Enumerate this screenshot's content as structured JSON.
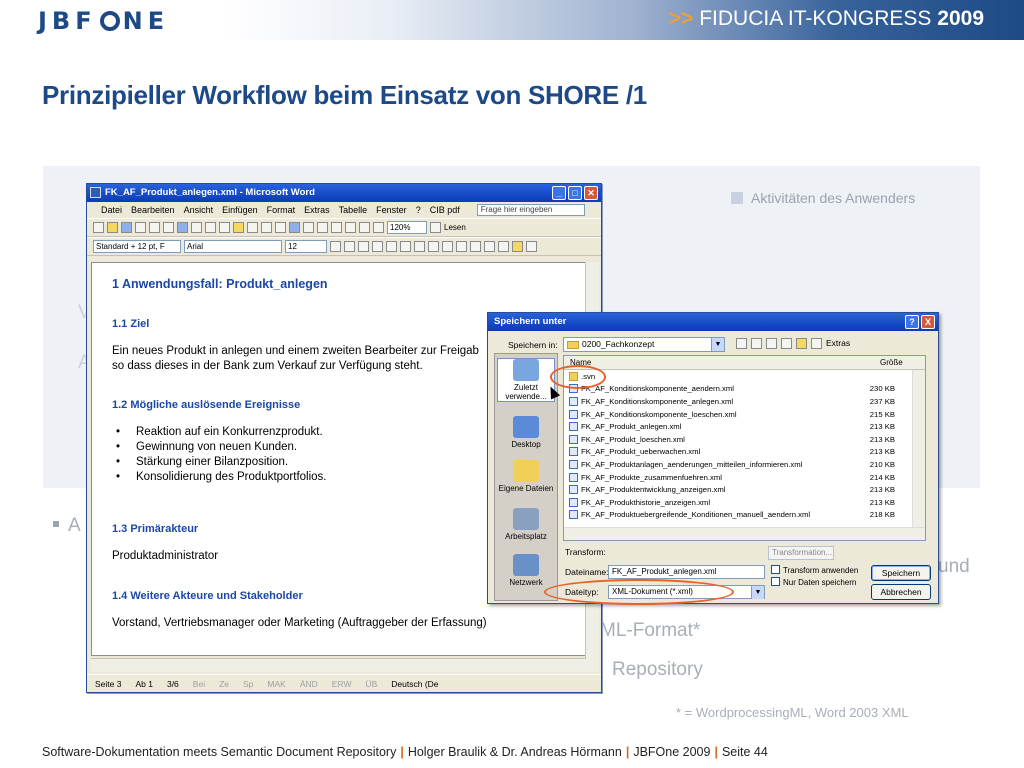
{
  "header": {
    "logo_pre": "JBF",
    "logo_post": "NE",
    "kongress_arrows": ">>",
    "kongress_text": "FIDUCIA IT-KONGRESS",
    "kongress_year": "2009"
  },
  "title": "Prinzipieller Workflow beim Einsatz von SHORE  /1",
  "panel": {
    "legend": "Aktivitäten des Anwenders",
    "ghost_left_1": "V",
    "ghost_left_2": "A",
    "ghost_bullet": "A",
    "ghost_und": "und",
    "ghost_ml": "ML-Format*",
    "ghost_repo": "Repository"
  },
  "footnote": "* = WordprocessingML, Word 2003 XML",
  "footer": {
    "part1": "Software-Dokumentation meets Semantic Document Repository",
    "sep": "|",
    "part2": "Holger Braulik & Dr. Andreas Hörmann",
    "part3": "JBFOne 2009",
    "part4": "Seite 44"
  },
  "word": {
    "title": "FK_AF_Produkt_anlegen.xml - Microsoft Word",
    "menu": [
      "Datei",
      "Bearbeiten",
      "Ansicht",
      "Einfügen",
      "Format",
      "Extras",
      "Tabelle",
      "Fenster",
      "?",
      "CIB pdf"
    ],
    "help_placeholder": "Frage hier eingeben",
    "zoom": "120%",
    "lesen": "Lesen",
    "style": "Standard + 12 pt, F",
    "font": "Arial",
    "size": "12",
    "doc": {
      "h1": "1  Anwendungsfall: Produkt_anlegen",
      "h_ziel": "1.1  Ziel",
      "ziel_line1": "Ein neues Produkt in anlegen und einem zweiten Bearbeiter zur Freigab",
      "ziel_line2": "so dass dieses in der Bank zum Verkauf zur Verfügung steht.",
      "h_ereignisse": "1.2  Mögliche auslösende Ereignisse",
      "ereignisse": [
        "Reaktion auf ein Konkurrenzprodukt.",
        "Gewinnung von neuen Kunden.",
        "Stärkung einer Bilanzposition.",
        "Konsolidierung des Produktportfolios."
      ],
      "h_primaer": "1.3  Primärakteur",
      "primaer": "Produktadministrator",
      "h_weitere": "1.4  Weitere Akteure und Stakeholder",
      "weitere": "Vorstand, Vertriebsmanager oder Marketing (Auftraggeber der Erfassung)"
    },
    "status": {
      "seite": "Seite  3",
      "ab": "Ab  1",
      "pages": "3/6",
      "bei": "Bei",
      "ze": "Ze",
      "sp": "Sp",
      "mak": "MAK",
      "aend": "ÄND",
      "erw": "ERW",
      "ub": "ÜB",
      "lang": "Deutsch (De"
    }
  },
  "save_dialog": {
    "title": "Speichern unter",
    "speichern_in_label": "Speichern in:",
    "folder": "0200_Fachkonzept",
    "extras": "Extras",
    "col_name": "Name",
    "col_size": "Größe",
    "places": [
      "Zuletzt verwende...",
      "Desktop",
      "Eigene Dateien",
      "Arbeitsplatz",
      "Netzwerk"
    ],
    "files": [
      {
        "name": ".svn",
        "size": "",
        "folder": true
      },
      {
        "name": "FK_AF_Konditionskomponente_aendern.xml",
        "size": "230 KB"
      },
      {
        "name": "FK_AF_Konditionskomponente_anlegen.xml",
        "size": "237 KB"
      },
      {
        "name": "FK_AF_Konditionskomponente_loeschen.xml",
        "size": "215 KB"
      },
      {
        "name": "FK_AF_Produkt_anlegen.xml",
        "size": "213 KB"
      },
      {
        "name": "FK_AF_Produkt_loeschen.xml",
        "size": "213 KB"
      },
      {
        "name": "FK_AF_Produkt_ueberwachen.xml",
        "size": "213 KB"
      },
      {
        "name": "FK_AF_Produktanlagen_aenderungen_mitteilen_informieren.xml",
        "size": "210 KB"
      },
      {
        "name": "FK_AF_Produkte_zusammenfuehren.xml",
        "size": "214 KB"
      },
      {
        "name": "FK_AF_Produktentwicklung_anzeigen.xml",
        "size": "213 KB"
      },
      {
        "name": "FK_AF_Produkthistorie_anzeigen.xml",
        "size": "213 KB"
      },
      {
        "name": "FK_AF_Produktuebergreifende_Konditionen_manuell_aendern.xml",
        "size": "218 KB"
      }
    ],
    "transform_label": "Transform:",
    "transform_placeholder": "Transformation...",
    "dateiname_label": "Dateiname:",
    "dateiname": "FK_AF_Produkt_anlegen.xml",
    "dateityp_label": "Dateityp:",
    "dateityp": "XML-Dokument (*.xml)",
    "chk_transform": "Transform anwenden",
    "chk_nurdaten": "Nur Daten speichern",
    "btn_save": "Speichern",
    "btn_cancel": "Abbrechen",
    "help_btn": "?",
    "close_btn": "X"
  },
  "colors": {
    "brand_blue": "#1d4a86",
    "accent_orange": "#e8602c"
  }
}
